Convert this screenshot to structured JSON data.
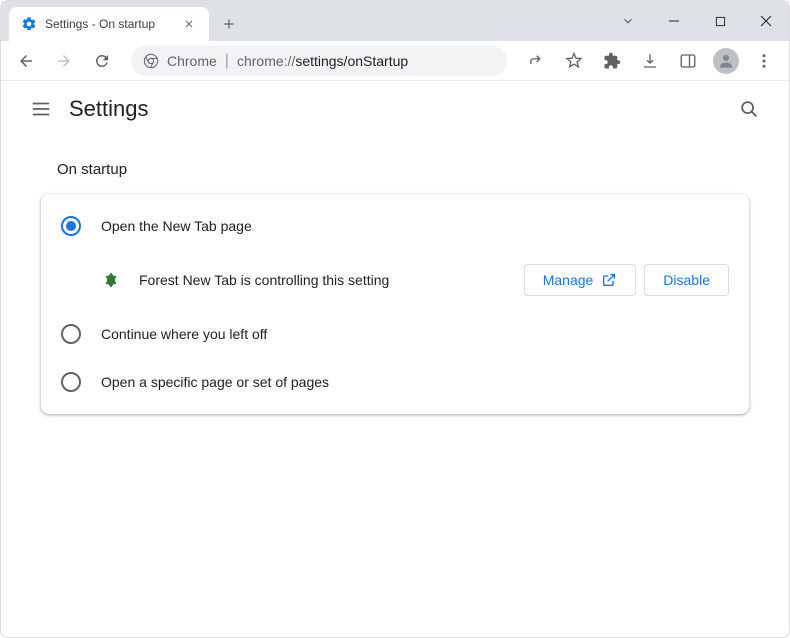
{
  "window": {
    "tab_title": "Settings - On startup"
  },
  "toolbar": {
    "scheme_label": "Chrome",
    "url_host": "chrome://",
    "url_path": "settings/onStartup"
  },
  "header": {
    "title": "Settings"
  },
  "section": {
    "title": "On startup",
    "options": [
      {
        "label": "Open the New Tab page",
        "selected": true
      },
      {
        "label": "Continue where you left off",
        "selected": false
      },
      {
        "label": "Open a specific page or set of pages",
        "selected": false
      }
    ],
    "extension_notice": {
      "text": "Forest New Tab is controlling this setting",
      "manage_label": "Manage",
      "disable_label": "Disable"
    }
  }
}
